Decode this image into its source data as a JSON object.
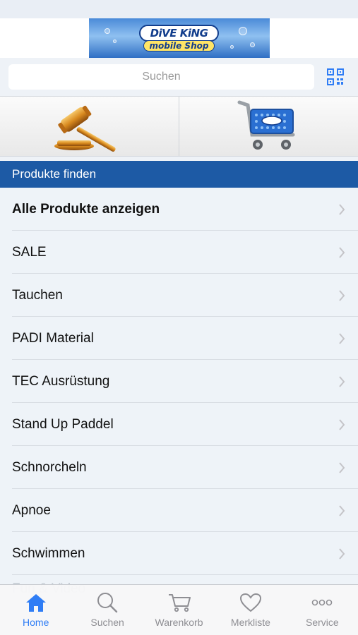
{
  "header": {
    "logo_title": "DiVE KiNG",
    "logo_subtitle": "mobile Shop"
  },
  "search": {
    "placeholder": "Suchen"
  },
  "section": {
    "title": "Produkte finden"
  },
  "categories": [
    {
      "label": "Alle Produkte anzeigen"
    },
    {
      "label": "SALE"
    },
    {
      "label": "Tauchen"
    },
    {
      "label": "PADI Material"
    },
    {
      "label": "TEC Ausrüstung"
    },
    {
      "label": "Stand Up Paddel"
    },
    {
      "label": "Schnorcheln"
    },
    {
      "label": "Apnoe"
    },
    {
      "label": "Schwimmen"
    }
  ],
  "partial_item": "Fun & Video",
  "tabs": [
    {
      "label": "Home",
      "icon": "home-icon",
      "active": true
    },
    {
      "label": "Suchen",
      "icon": "search-icon",
      "active": false
    },
    {
      "label": "Warenkorb",
      "icon": "cart-icon",
      "active": false
    },
    {
      "label": "Merkliste",
      "icon": "heart-icon",
      "active": false
    },
    {
      "label": "Service",
      "icon": "more-icon",
      "active": false
    }
  ],
  "colors": {
    "accent": "#2f7df5",
    "section_header": "#1d5aa5"
  }
}
